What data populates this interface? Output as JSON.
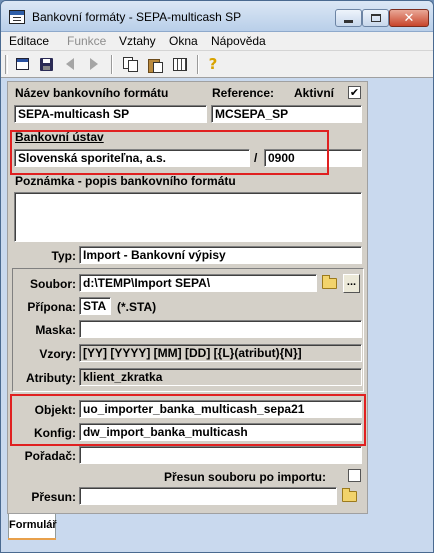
{
  "window": {
    "title": "Bankovní formáty - SEPA-multicash SP",
    "minimize": "minimize",
    "maximize": "maximize",
    "close": "✕"
  },
  "menu": [
    {
      "label": "Editace",
      "disabled": false
    },
    {
      "label": "Funkce",
      "disabled": true
    },
    {
      "label": "Vztahy",
      "disabled": false
    },
    {
      "label": "Okna",
      "disabled": false
    },
    {
      "label": "Nápověda",
      "disabled": false
    }
  ],
  "toolbar": {
    "icons": [
      "window-icon",
      "save-icon",
      "back-arrow-icon",
      "forward-arrow-icon",
      "copy-icon",
      "paste-icon",
      "columns-icon",
      "help-icon"
    ],
    "help_glyph": "?"
  },
  "form": {
    "nazev_label": "Název bankovního formátu",
    "nazev_value": "SEPA-multicash SP",
    "reference_label": "Reference:",
    "reference_value": "MCSEPA_SP",
    "aktivni_label": "Aktivní",
    "aktivni_checked": "✔",
    "banka_label": "Bankovní ústav",
    "banka_value": "Slovenská sporiteľna, a.s.",
    "slash": "/",
    "kod_banky": "0900",
    "poznamka_label": "Poznámka - popis bankovního formátu",
    "poznamka_value": "",
    "typ_label": "Typ:",
    "typ_value": "Import - Bankovní výpisy",
    "soubor_label": "Soubor:",
    "soubor_value": "d:\\TEMP\\Import SEPA\\",
    "dots": "...",
    "pripona_label": "Přípona:",
    "pripona_value": "STA",
    "pripona_hint": "(*.STA)",
    "maska_label": "Maska:",
    "maska_value": "",
    "vzory_label": "Vzory:",
    "vzory_value": "[YY] [YYYY] [MM] [DD] [{L}(atribut){N}]",
    "atributy_label": "Atributy:",
    "atributy_value": "klient_zkratka",
    "objekt_label": "Objekt:",
    "objekt_value": "uo_importer_banka_multicash_sepa21",
    "konfig_label": "Konfig:",
    "konfig_value": "dw_import_banka_multicash",
    "poradac_label": "Pořadač:",
    "poradac_value": "",
    "presun_po_importu_label": "Přesun souboru po importu:",
    "presun_label": "Přesun:",
    "presun_value": ""
  },
  "tabs": [
    {
      "label": "Formulář",
      "active": true
    }
  ],
  "colors": {
    "highlight_box": "#e02020",
    "tab_accent": "#e8a04b"
  }
}
